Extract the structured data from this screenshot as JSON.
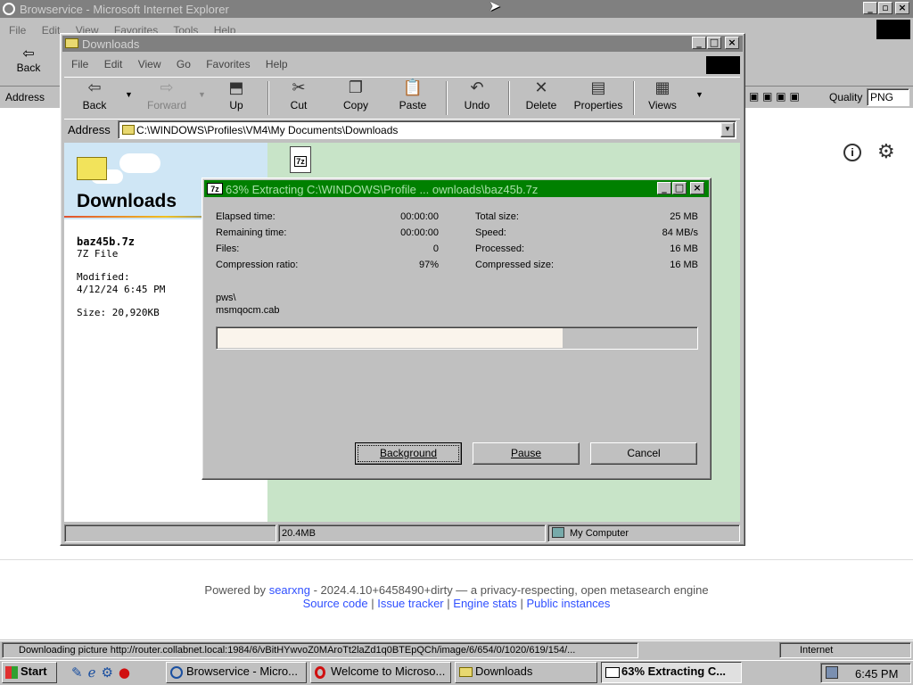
{
  "ie": {
    "title": "Browservice - Microsoft Internet Explorer",
    "menu": [
      "File",
      "Edit",
      "View",
      "Favorites",
      "Tools",
      "Help"
    ],
    "back_label": "Back",
    "address_label": "Address",
    "quality_label": "Quality",
    "quality_value": "PNG"
  },
  "searx": {
    "powered_prefix": "Powered by",
    "searxng": "searxng",
    "version_text": "- 2024.4.10+6458490+dirty — a privacy-respecting, open metasearch engine",
    "links": [
      "Source code",
      "Issue tracker",
      "Engine stats",
      "Public instances"
    ],
    "separator": "|"
  },
  "explorer": {
    "title": "Downloads",
    "menu": [
      "File",
      "Edit",
      "View",
      "Go",
      "Favorites",
      "Help"
    ],
    "toolbar": [
      "Back",
      "Forward",
      "Up",
      "Cut",
      "Copy",
      "Paste",
      "Undo",
      "Delete",
      "Properties",
      "Views"
    ],
    "address_label": "Address",
    "address_value": "C:\\WINDOWS\\Profiles\\VM4\\My Documents\\Downloads",
    "folder_heading": "Downloads",
    "file_name": "baz45b.7z",
    "file_type": "7Z File",
    "modified_label": "Modified:",
    "modified_value": "4/12/24 6:45 PM",
    "size_text": "Size: 20,920KB",
    "file_icon_label": "7z",
    "status_size": "20.4MB",
    "status_zone": "My Computer"
  },
  "extract": {
    "title": "63% Extracting C:\\WINDOWS\\Profile ... ownloads\\baz45b.7z",
    "icon_label": "7z",
    "left": [
      {
        "label": "Elapsed time:",
        "value": "00:00:00"
      },
      {
        "label": "Remaining time:",
        "value": "00:00:00"
      },
      {
        "label": "Files:",
        "value": "0"
      },
      {
        "label": "Compression ratio:",
        "value": "97%"
      }
    ],
    "right": [
      {
        "label": "Total size:",
        "value": "25 MB"
      },
      {
        "label": "Speed:",
        "value": "84 MB/s"
      },
      {
        "label": "Processed:",
        "value": "16 MB"
      },
      {
        "label": "Compressed size:",
        "value": "16 MB"
      }
    ],
    "path_line1": "pws\\",
    "path_line2": "msmqocm.cab",
    "progress_fraction": 0.72,
    "buttons": {
      "background": "Background",
      "pause": "Pause",
      "cancel": "Cancel"
    }
  },
  "ie_status": {
    "text": "Downloading picture http://router.collabnet.local:1984/6/vBitHYwvoZ0MAroTt2laZd1q0BTEpQCh/image/6/654/0/1020/619/154/...",
    "zone": "Internet"
  },
  "taskbar": {
    "start": "Start",
    "tasks": [
      "Browservice - Micro...",
      "Welcome to Microso...",
      "Downloads",
      "63% Extracting C..."
    ],
    "clock": "6:45 PM"
  },
  "colors": {
    "inactive_title": "#808080",
    "extract_title": "#008000",
    "webview_green": "#c8e4c8",
    "progress_fill": "#faf4ec"
  }
}
